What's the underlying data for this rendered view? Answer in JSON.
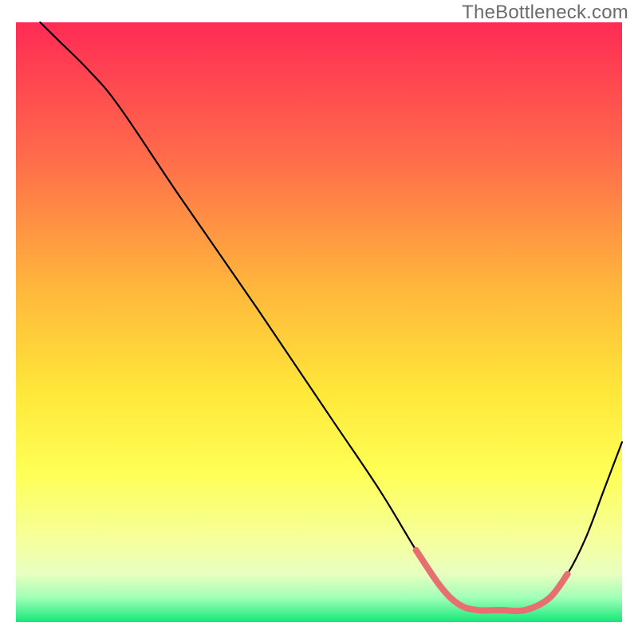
{
  "watermark": "TheBottleneck.com",
  "chart_data": {
    "type": "line",
    "title": "",
    "xlabel": "",
    "ylabel": "",
    "xlim": [
      0,
      100
    ],
    "ylim": [
      0,
      100
    ],
    "gradient_stops": [
      {
        "offset": 0,
        "color": "#ff2b55"
      },
      {
        "offset": 22,
        "color": "#ff6a4b"
      },
      {
        "offset": 45,
        "color": "#ffb93b"
      },
      {
        "offset": 62,
        "color": "#ffe83a"
      },
      {
        "offset": 75,
        "color": "#ffff55"
      },
      {
        "offset": 86,
        "color": "#f6ff9a"
      },
      {
        "offset": 92,
        "color": "#e8ffc0"
      },
      {
        "offset": 96,
        "color": "#9fffb6"
      },
      {
        "offset": 100,
        "color": "#15e878"
      }
    ],
    "series": [
      {
        "name": "bottleneck-curve",
        "color": "#000000",
        "stroke_width": 2.2,
        "points": [
          {
            "x": 4,
            "y": 100
          },
          {
            "x": 7,
            "y": 97
          },
          {
            "x": 12,
            "y": 92
          },
          {
            "x": 17,
            "y": 86
          },
          {
            "x": 27,
            "y": 71
          },
          {
            "x": 40,
            "y": 52
          },
          {
            "x": 52,
            "y": 34
          },
          {
            "x": 60,
            "y": 22
          },
          {
            "x": 66,
            "y": 12
          },
          {
            "x": 70,
            "y": 6
          },
          {
            "x": 73,
            "y": 3
          },
          {
            "x": 76,
            "y": 2
          },
          {
            "x": 80,
            "y": 2
          },
          {
            "x": 84,
            "y": 2
          },
          {
            "x": 88,
            "y": 4
          },
          {
            "x": 91,
            "y": 8
          },
          {
            "x": 94,
            "y": 14
          },
          {
            "x": 97,
            "y": 22
          },
          {
            "x": 100,
            "y": 30
          }
        ]
      },
      {
        "name": "highlight-segment",
        "color": "#e67070",
        "stroke_width": 8,
        "points": [
          {
            "x": 66,
            "y": 12
          },
          {
            "x": 70,
            "y": 6
          },
          {
            "x": 73,
            "y": 3
          },
          {
            "x": 76,
            "y": 2
          },
          {
            "x": 80,
            "y": 2
          },
          {
            "x": 84,
            "y": 2
          },
          {
            "x": 88,
            "y": 4
          },
          {
            "x": 91,
            "y": 8
          }
        ]
      }
    ]
  }
}
